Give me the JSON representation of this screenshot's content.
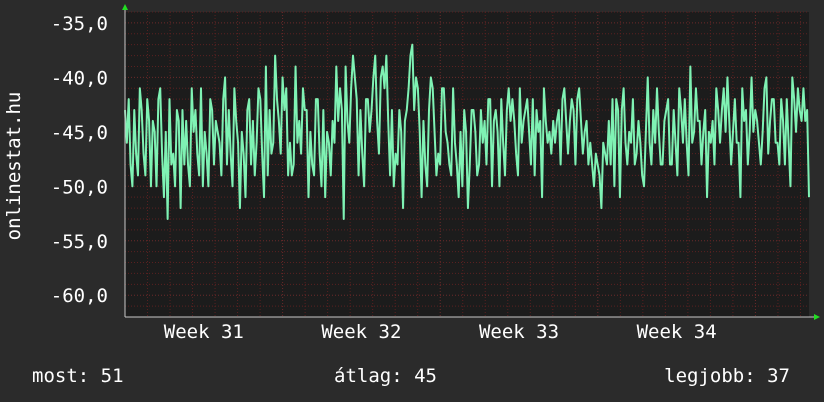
{
  "chart_data": {
    "type": "line",
    "ylabel": "onlinestat.hu",
    "ylim": [
      -62,
      -34
    ],
    "ytick_values": [
      -35,
      -40,
      -45,
      -50,
      -55,
      -60
    ],
    "yticks": [
      "-35,0",
      "-40,0",
      "-45,0",
      "-50,0",
      "-55,0",
      "-60,0"
    ],
    "xticks": [
      "Week 31",
      "Week 32",
      "Week 33",
      "Week 34"
    ],
    "xtick_positions": [
      0.5,
      1.5,
      2.5,
      3.5
    ],
    "xlim": [
      0,
      4.34
    ],
    "grid": true,
    "series": [
      {
        "values": [
          -43,
          -46,
          -42,
          -48,
          -50,
          -43,
          -47,
          -49,
          -41,
          -43,
          -47,
          -49,
          -42,
          -44,
          -50,
          -44,
          -45,
          -50,
          -42,
          -41,
          -47,
          -51,
          -45,
          -53,
          -42,
          -48,
          -47,
          -50,
          -43,
          -44,
          -52,
          -43,
          -48,
          -44,
          -48,
          -50,
          -41,
          -45,
          -43,
          -47,
          -49,
          -41,
          -50,
          -45,
          -47,
          -50,
          -42,
          -43,
          -48,
          -44,
          -45,
          -46,
          -49,
          -42,
          -40,
          -48,
          -43,
          -47,
          -50,
          -41,
          -44,
          -46,
          -52,
          -45,
          -47,
          -51,
          -43,
          -42,
          -48,
          -44,
          -49,
          -46,
          -41,
          -42,
          -47,
          -51,
          -39,
          -49,
          -43,
          -47,
          -46,
          -38,
          -42,
          -44,
          -47,
          -40,
          -43,
          -41,
          -49,
          -46,
          -49,
          -48,
          -39,
          -46,
          -44,
          -47,
          -41,
          -43,
          -43,
          -51,
          -45,
          -48,
          -49,
          -42,
          -42,
          -47,
          -50,
          -43,
          -51,
          -45,
          -46,
          -49,
          -44,
          -46,
          -39,
          -44,
          -41,
          -43,
          -53,
          -39,
          -44,
          -46,
          -41,
          -38,
          -40,
          -42,
          -49,
          -43,
          -47,
          -50,
          -42,
          -42,
          -45,
          -43,
          -40,
          -38,
          -44,
          -47,
          -40,
          -39,
          -41,
          -38,
          -44,
          -49,
          -43,
          -50,
          -47,
          -48,
          -43,
          -45,
          -52,
          -44,
          -43,
          -41,
          -38,
          -37,
          -43,
          -40,
          -41,
          -45,
          -51,
          -44,
          -48,
          -50,
          -43,
          -40,
          -41,
          -45,
          -49,
          -47,
          -48,
          -41,
          -41,
          -45,
          -46,
          -48,
          -49,
          -41,
          -46,
          -48,
          -51,
          -45,
          -50,
          -43,
          -45,
          -52,
          -48,
          -43,
          -43,
          -45,
          -49,
          -48,
          -43,
          -46,
          -44,
          -48,
          -42,
          -42,
          -50,
          -44,
          -43,
          -45,
          -50,
          -42,
          -46,
          -49,
          -43,
          -41,
          -44,
          -42,
          -44,
          -47,
          -49,
          -41,
          -46,
          -44,
          -43,
          -42,
          -45,
          -48,
          -42,
          -49,
          -43,
          -45,
          -44,
          -51,
          -41,
          -44,
          -46,
          -45,
          -47,
          -44,
          -46,
          -44,
          -43,
          -48,
          -42,
          -41,
          -44,
          -47,
          -44,
          -42,
          -43,
          -48,
          -42,
          -41,
          -44,
          -47,
          -45,
          -44,
          -48,
          -46,
          -48,
          -50,
          -47,
          -48,
          -49,
          -52,
          -46,
          -47,
          -48,
          -44,
          -48,
          -42,
          -50,
          -42,
          -43,
          -51,
          -43,
          -41,
          -46,
          -48,
          -45,
          -46,
          -42,
          -48,
          -47,
          -44,
          -46,
          -49,
          -50,
          -45,
          -40,
          -46,
          -48,
          -43,
          -46,
          -41,
          -45,
          -48,
          -48,
          -44,
          -43,
          -42,
          -48,
          -48,
          -43,
          -46,
          -49,
          -41,
          -43,
          -46,
          -42,
          -46,
          -49,
          -39,
          -46,
          -45,
          -41,
          -44,
          -44,
          -48,
          -45,
          -43,
          -51,
          -45,
          -46,
          -44,
          -48,
          -41,
          -43,
          -46,
          -43,
          -41,
          -45,
          -40,
          -44,
          -48,
          -45,
          -42,
          -46,
          -46,
          -51,
          -41,
          -44,
          -43,
          -48,
          -45,
          -40,
          -45,
          -43,
          -44,
          -46,
          -48,
          -45,
          -41,
          -40,
          -47,
          -44,
          -42,
          -42,
          -46,
          -46,
          -48,
          -42,
          -44,
          -48,
          -42,
          -46,
          -50,
          -40,
          -42,
          -45,
          -41,
          -43,
          -44,
          -41,
          -44,
          -43,
          -51
        ],
        "color": "#7ff2b4"
      }
    ]
  },
  "footer": {
    "current_label": "most: 51",
    "average_label": "átlag: 45",
    "best_label": "legjobb: 37"
  },
  "colors": {
    "background": "#2b2b2b",
    "plot_background": "#1c1c1c",
    "grid_minor": "#5a2020",
    "grid_major": "#6b2a2a",
    "text": "#ffffff",
    "arrow": "#22dd22"
  }
}
